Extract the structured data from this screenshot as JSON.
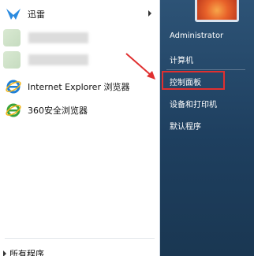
{
  "left_menu": {
    "items": [
      {
        "label": "迅雷",
        "icon": "xunlei-icon",
        "has_submenu": true
      },
      {
        "label": "Internet Explorer 浏览器",
        "icon": "internet-explorer-icon"
      },
      {
        "label": "360安全浏览器",
        "icon": "360-browser-icon"
      }
    ],
    "all_programs": "所有程序"
  },
  "right_menu": {
    "user": "Administrator",
    "items": [
      "计算机",
      "控制面板",
      "设备和打印机",
      "默认程序"
    ]
  },
  "colors": {
    "highlight": "#e03030",
    "right_pane": "#1e3f5f"
  }
}
